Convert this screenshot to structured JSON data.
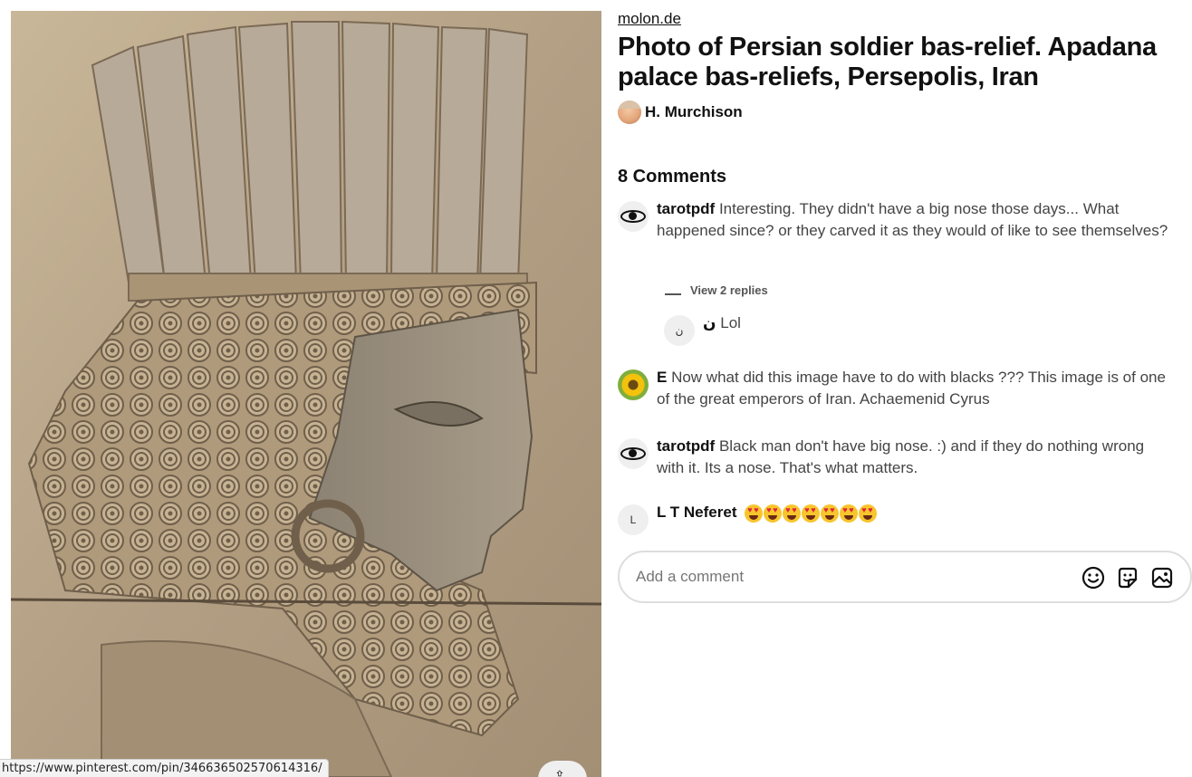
{
  "image": {
    "alt": ""
  },
  "status_url": "https://www.pinterest.com/pin/346636502570614316/",
  "pin": {
    "source": "molon.de",
    "title": "Photo of Persian soldier bas-relief. Apadana palace bas-reliefs, Persepolis, Iran",
    "author": "H. Murchison"
  },
  "comments": {
    "heading": "8 Comments",
    "items": [
      {
        "avatar_icon": "eye-icon",
        "user": "tarotpdf",
        "text": "Interesting. They didn't have a big nose those days... What happened since? or they carved it as they would of like to see themselves?"
      },
      {
        "avatar_icon": "sunflower-avatar",
        "user": "E",
        "text": "Now what did this image have to do with blacks ??? This image is of one of the great emperors of Iran. Achaemenid Cyrus"
      },
      {
        "avatar_icon": "eye-icon",
        "user": "tarotpdf",
        "text": "Black man don't have big nose. :) and if they do nothing wrong with it. Its a nose. That's what matters."
      },
      {
        "avatar_letter": "L",
        "user": "L T Neferet",
        "text": "",
        "emoji_count": 7,
        "emoji_icon": "heart-eyes-emoji"
      }
    ],
    "view_replies": "View 2 replies",
    "reply": {
      "avatar_letter": "ن",
      "user": "ن",
      "text": "Lol"
    }
  },
  "comment_box": {
    "placeholder": "Add a comment",
    "icons": [
      "emoji-icon",
      "sticker-icon",
      "image-icon"
    ]
  },
  "colors": {
    "text": "#111111",
    "muted": "#444444",
    "border": "#dddddd",
    "relief_stone": "#b9a78c"
  }
}
